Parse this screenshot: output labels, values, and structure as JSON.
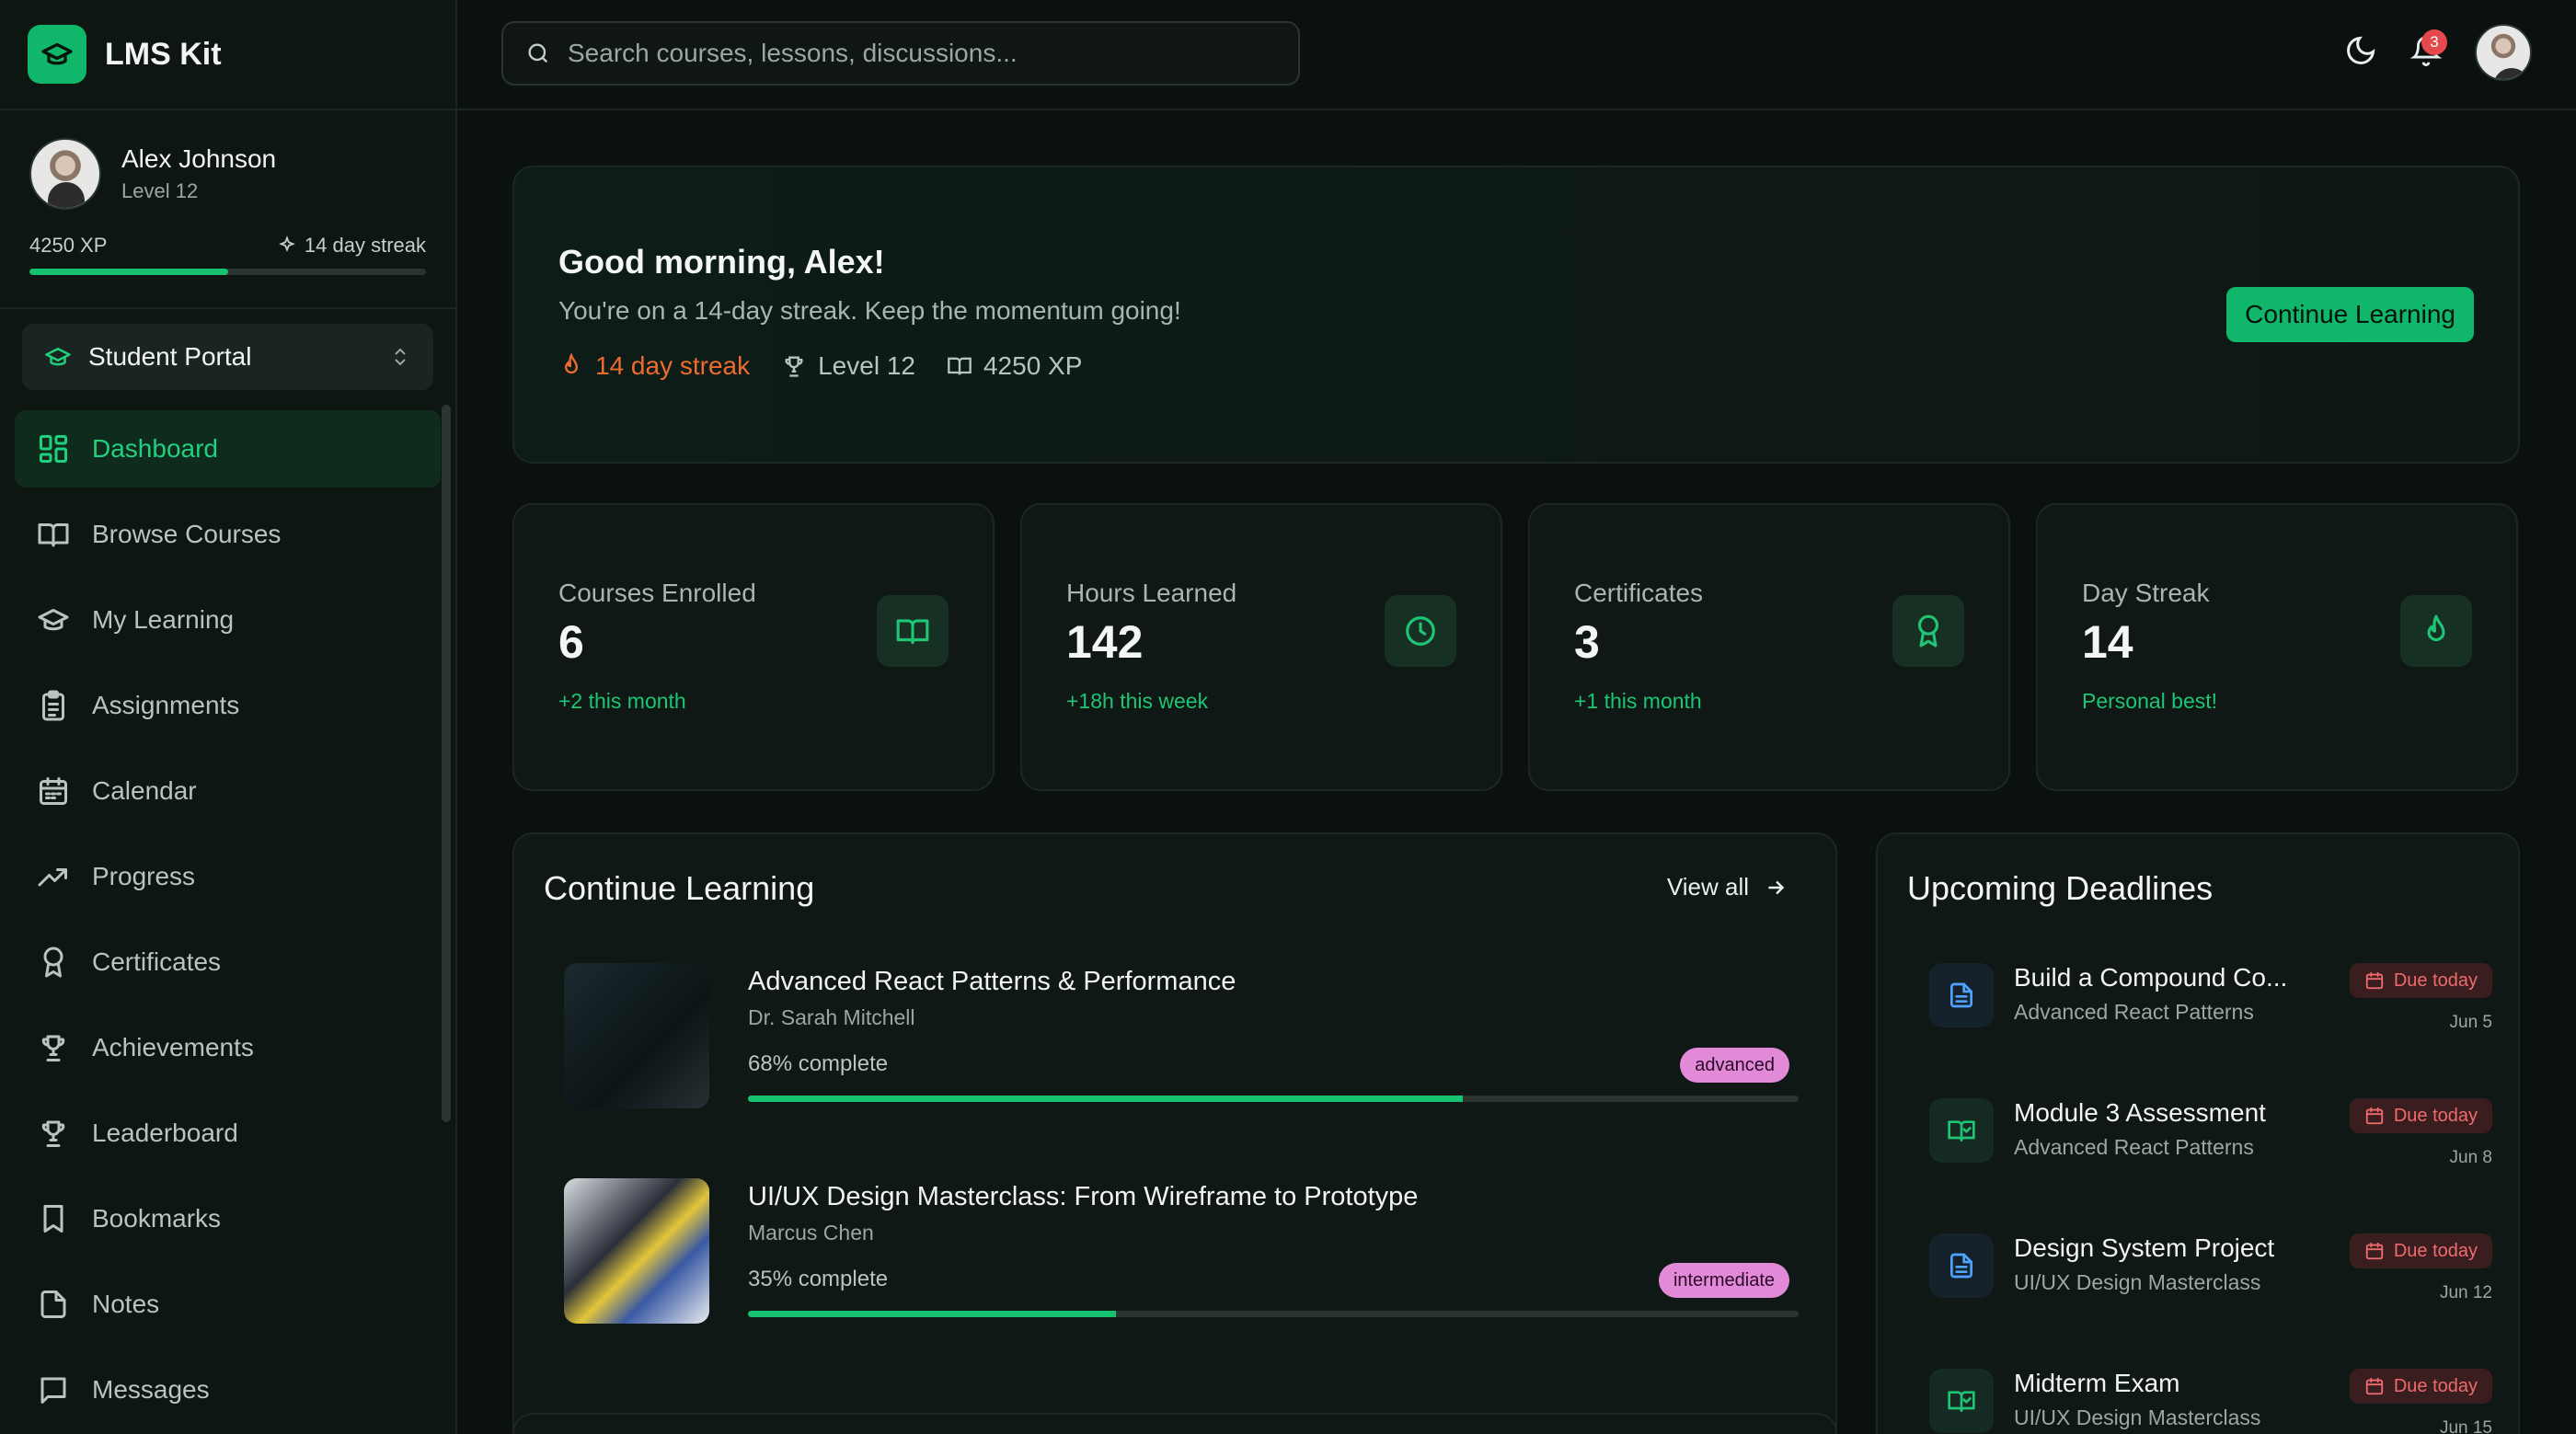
{
  "brand": {
    "name": "LMS Kit"
  },
  "user": {
    "name": "Alex Johnson",
    "level": "Level 12",
    "xp": "4250 XP",
    "streak": "14 day streak",
    "xp_progress": 0.5
  },
  "portal": {
    "label": "Student Portal"
  },
  "nav": [
    {
      "label": "Dashboard",
      "icon": "dashboard-icon",
      "active": true
    },
    {
      "label": "Browse Courses",
      "icon": "book-open-icon"
    },
    {
      "label": "My Learning",
      "icon": "graduation-cap-icon"
    },
    {
      "label": "Assignments",
      "icon": "clipboard-icon"
    },
    {
      "label": "Calendar",
      "icon": "calendar-icon"
    },
    {
      "label": "Progress",
      "icon": "trending-up-icon"
    },
    {
      "label": "Certificates",
      "icon": "award-icon"
    },
    {
      "label": "Achievements",
      "icon": "trophy-icon"
    },
    {
      "label": "Leaderboard",
      "icon": "trophy-icon"
    },
    {
      "label": "Bookmarks",
      "icon": "bookmark-icon"
    },
    {
      "label": "Notes",
      "icon": "file-icon"
    },
    {
      "label": "Messages",
      "icon": "message-icon"
    }
  ],
  "search": {
    "placeholder": "Search courses, lessons, discussions..."
  },
  "topbar": {
    "notifications": "3"
  },
  "hero": {
    "title": "Good morning, Alex!",
    "subtitle": "You're on a 14-day streak. Keep the momentum going!",
    "streak": "14 day streak",
    "level": "Level 12",
    "xp": "4250 XP",
    "cta": "Continue Learning"
  },
  "stats": [
    {
      "label": "Courses Enrolled",
      "value": "6",
      "sub": "+2 this month",
      "icon": "book-open-icon"
    },
    {
      "label": "Hours Learned",
      "value": "142",
      "sub": "+18h this week",
      "icon": "clock-icon"
    },
    {
      "label": "Certificates",
      "value": "3",
      "sub": "+1 this month",
      "icon": "award-icon"
    },
    {
      "label": "Day Streak",
      "value": "14",
      "sub": "Personal best!",
      "icon": "flame-icon"
    }
  ],
  "continue_learning": {
    "title": "Continue Learning",
    "view_all": "View all",
    "courses": [
      {
        "title": "Advanced React Patterns & Performance",
        "author": "Dr. Sarah Mitchell",
        "progress_label": "68% complete",
        "progress": 0.68,
        "level": "advanced"
      },
      {
        "title": "UI/UX Design Masterclass: From Wireframe to Prototype",
        "author": "Marcus Chen",
        "progress_label": "35% complete",
        "progress": 0.35,
        "level": "intermediate"
      }
    ]
  },
  "deadlines": {
    "title": "Upcoming Deadlines",
    "items": [
      {
        "name": "Build a Compound Co...",
        "course": "Advanced React Patterns",
        "due": "Due today",
        "date": "Jun 5",
        "icon": "file-text-icon"
      },
      {
        "name": "Module 3 Assessment",
        "course": "Advanced React Patterns",
        "due": "Due today",
        "date": "Jun 8",
        "icon": "book-check-icon"
      },
      {
        "name": "Design System Project",
        "course": "UI/UX Design Masterclass",
        "due": "Due today",
        "date": "Jun 12",
        "icon": "file-text-icon"
      },
      {
        "name": "Midterm Exam",
        "course": "UI/UX Design Masterclass",
        "due": "Due today",
        "date": "Jun 15",
        "icon": "book-check-icon"
      }
    ]
  },
  "colors": {
    "accent": "#16c172",
    "streak": "#ee6b2f",
    "danger": "#ef6b6e",
    "tag": "#e28ad8"
  }
}
